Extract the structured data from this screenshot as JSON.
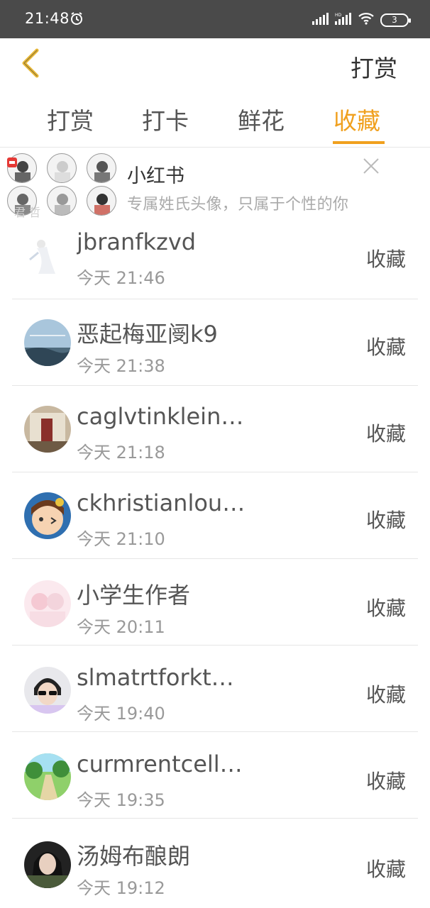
{
  "status_bar": {
    "time": "21:48",
    "battery": "3"
  },
  "header": {
    "title": "打赏"
  },
  "tabs": [
    {
      "label": "打赏"
    },
    {
      "label": "打卡"
    },
    {
      "label": "鲜花"
    },
    {
      "label": "收藏",
      "active": true
    }
  ],
  "ad": {
    "title": "小红书",
    "description": "专属姓氏头像，只属于个性的你",
    "badge": "小红书",
    "watermark": "君 哲"
  },
  "list": [
    {
      "name": "jbranfkzvd",
      "time": "今天 21:46",
      "action": "收藏"
    },
    {
      "name": "恶起梅亚阌k9",
      "time": "今天 21:38",
      "action": "收藏"
    },
    {
      "name": "caglvtinkleinj…",
      "time": "今天 21:18",
      "action": "收藏"
    },
    {
      "name": "ckhristianlou…",
      "time": "今天 21:10",
      "action": "收藏"
    },
    {
      "name": "小学生作者",
      "time": "今天 20:11",
      "action": "收藏"
    },
    {
      "name": "slmatrtforkt…",
      "time": "今天 19:40",
      "action": "收藏"
    },
    {
      "name": "curmrentcelli…",
      "time": "今天 19:35",
      "action": "收藏"
    },
    {
      "name": "汤姆布酿朗",
      "time": "今天 19:12",
      "action": "收藏"
    }
  ],
  "colors": {
    "accent": "#f0a01e",
    "statusbar": "#4a4a4a",
    "divider": "#e6e6e6"
  }
}
